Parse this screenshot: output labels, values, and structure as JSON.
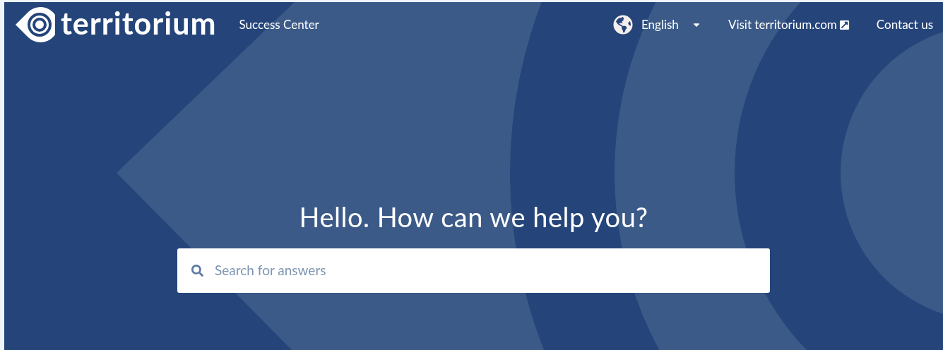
{
  "header": {
    "logo": "territorium",
    "site_name": "Success Center",
    "language": {
      "label": "English"
    },
    "links": [
      {
        "label": "Visit territorium.com",
        "external": true
      },
      {
        "label": "Contact us",
        "external": false
      }
    ]
  },
  "hero": {
    "heading": "Hello. How can we help you?",
    "search": {
      "placeholder": "Search for answers"
    }
  }
}
